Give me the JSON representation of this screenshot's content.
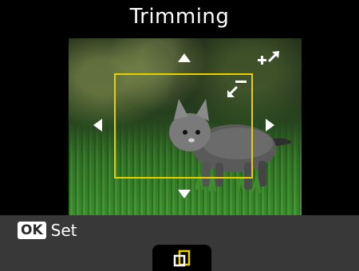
{
  "screen": {
    "title": "Trimming"
  },
  "footer": {
    "ok_key": "OK",
    "ok_label": "Set"
  },
  "icons": {
    "up": "arrow-up-icon",
    "down": "arrow-down-icon",
    "left": "arrow-left-icon",
    "right": "arrow-right-icon",
    "zoom_in": "zoom-in-icon",
    "zoom_out": "zoom-out-icon",
    "rotate": "rotate-crop-icon"
  },
  "colors": {
    "crop_frame": "#e8d000",
    "footer_bg": "#383838",
    "background": "#000000"
  }
}
